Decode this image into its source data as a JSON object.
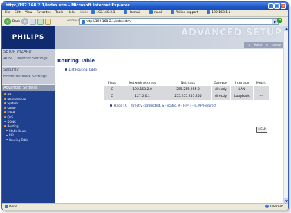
{
  "window": {
    "title": "http://192.168.2.1/index.stm - Microsoft Internet Explorer"
  },
  "menubar": {
    "items": [
      "File",
      "Edit",
      "View",
      "Favorites",
      "Tools",
      "Help"
    ],
    "links_label": "Links",
    "links": [
      "192.168.2.1",
      "Hotmail",
      "nu.nl",
      "Philips support",
      "192.168.1.1"
    ]
  },
  "toolbar": {
    "back_label": "Back",
    "address_label": "Address",
    "address_value": "http://192.168.2.1/index.stm",
    "go_label": "Go"
  },
  "header": {
    "logo": "PHILIPS",
    "title": "ADVANCED SETUP",
    "home_link": "Home",
    "logout_link": "Logout"
  },
  "nav": {
    "setup_wizard": "SETUP WIZARD",
    "adsl": "ADSL / Internet Settings",
    "security": "Security",
    "home_network": "Home Network Settings",
    "advanced": "Advanced Settings",
    "sub_items": [
      "NAT",
      "Maintenance",
      "System",
      "SNMP",
      "UPnP",
      "QoS",
      "DDNS",
      "Routing"
    ],
    "routing_items": [
      "Static Route",
      "RIP",
      "Routing Table"
    ]
  },
  "main": {
    "title": "Routing Table",
    "list_label": "List Routing Table:",
    "columns": [
      "Flags",
      "Network Address",
      "Netmask",
      "Gateway",
      "Interface",
      "Metric"
    ],
    "rows": [
      [
        "C",
        "192.168.2.0",
        "255.255.255.0",
        "directly",
        "LAN",
        "---"
      ],
      [
        "C",
        "127.0.0.1",
        "255.255.255.255",
        "directly",
        "Loopback",
        "---"
      ]
    ],
    "flags_note": "Flags : C - directly connected, S - static, R - RIP, I - ICMP Redirect",
    "help_label": "HELP"
  },
  "status": {
    "left": "Done",
    "right": "Internet"
  },
  "colors": {
    "nav_dark": "#1f3f8f",
    "logo_bg": "#0f2a6e",
    "accent_text": "#1e3c8c"
  }
}
